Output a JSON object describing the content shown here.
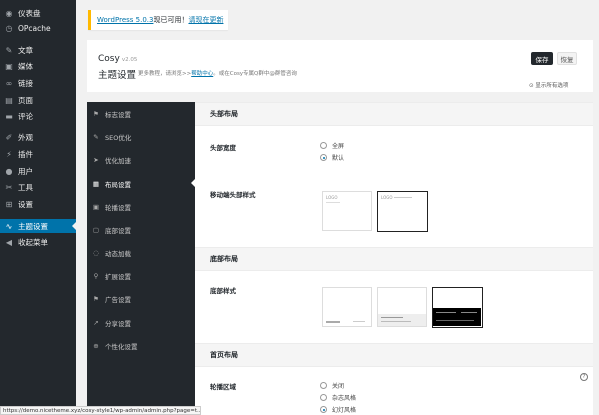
{
  "wp_menu": {
    "items": [
      {
        "icon": "dashboard-icon",
        "glyph": "◉",
        "label": "仪表盘"
      },
      {
        "icon": "history-icon",
        "glyph": "◷",
        "label": "OPcache"
      },
      {
        "icon": "pin-icon",
        "glyph": "✎",
        "label": "文章"
      },
      {
        "icon": "media-icon",
        "glyph": "▣",
        "label": "媒体"
      },
      {
        "icon": "link-icon",
        "glyph": "∞",
        "label": "链接"
      },
      {
        "icon": "page-icon",
        "glyph": "▤",
        "label": "页面"
      },
      {
        "icon": "comment-icon",
        "glyph": "▬",
        "label": "评论"
      },
      {
        "icon": "appearance-icon",
        "glyph": "✐",
        "label": "外观"
      },
      {
        "icon": "plugin-icon",
        "glyph": "⚡",
        "label": "插件"
      },
      {
        "icon": "user-icon",
        "glyph": "●",
        "label": "用户"
      },
      {
        "icon": "tools-icon",
        "glyph": "✂",
        "label": "工具"
      },
      {
        "icon": "settings-icon",
        "glyph": "⊞",
        "label": "设置"
      },
      {
        "icon": "theme-settings-icon",
        "glyph": "∿",
        "label": "主题设置"
      },
      {
        "icon": "collapse-icon",
        "glyph": "◀",
        "label": "收起菜单"
      }
    ]
  },
  "notice": {
    "link1": "WordPress 5.0.3",
    "text": "现已可用！",
    "link2": "请现在更新"
  },
  "header": {
    "brand": "Cosy",
    "version": "v2.05",
    "title": "主题设置",
    "desc_prefix": "更多教程，请浏览>>",
    "desc_link": "帮助中心",
    "desc_suffix": "。或在Cosy专属Q群中@群管咨询",
    "save_label": "保存",
    "reset_label": "恢复",
    "show_all_label": "显示所有选项"
  },
  "options_nav": {
    "items": [
      {
        "icon": "flag-icon",
        "glyph": "⚑",
        "label": "标志设置"
      },
      {
        "icon": "seo-icon",
        "glyph": "✎",
        "label": "SEO优化"
      },
      {
        "icon": "rocket-icon",
        "glyph": "➤",
        "label": "优化加速"
      },
      {
        "icon": "layout-icon",
        "glyph": "▦",
        "label": "布局设置"
      },
      {
        "icon": "carousel-icon",
        "glyph": "▣",
        "label": "轮播设置"
      },
      {
        "icon": "footer-icon",
        "glyph": "▢",
        "label": "底部设置"
      },
      {
        "icon": "loading-icon",
        "glyph": "◌",
        "label": "动态加载"
      },
      {
        "icon": "extend-icon",
        "glyph": "⚲",
        "label": "扩展设置"
      },
      {
        "icon": "ad-icon",
        "glyph": "⚑",
        "label": "广告设置"
      },
      {
        "icon": "share-icon",
        "glyph": "↗",
        "label": "分享设置"
      },
      {
        "icon": "personal-icon",
        "glyph": "⊕",
        "label": "个性化设置"
      }
    ]
  },
  "content": {
    "header_section": {
      "title": "头部布局",
      "width_label": "头部宽度",
      "width_options": [
        "全屏",
        "默认"
      ],
      "width_selected": "默认",
      "mobile_label": "移动端头部样式",
      "thumb_text": "LOGO"
    },
    "footer_section": {
      "title": "底部布局",
      "style_label": "底部样式"
    },
    "home_section": {
      "title": "首页布局",
      "carousel_label": "轮播区域",
      "carousel_options": [
        "关闭",
        "杂志风格",
        "幻灯风格"
      ],
      "carousel_selected": "幻灯风格"
    }
  },
  "statusbar": "https://demo.nicetheme.xyz/cosy-style1/wp-admin/admin.php?page=t..."
}
